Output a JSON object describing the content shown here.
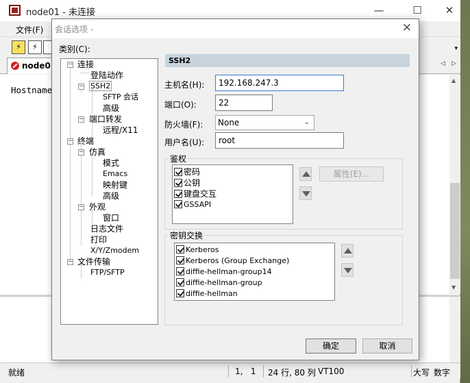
{
  "main_window": {
    "title": "node01 - 未连接",
    "controls": {
      "minimize": "—",
      "maximize": "☐",
      "close": "✕"
    },
    "menu": {
      "file": "文件(F)"
    },
    "toolbar_chevron": "▾",
    "tab": {
      "label": "node01"
    },
    "tab_nav": {
      "prev": "◁",
      "next": "▷"
    },
    "terminal_text": "Hostname",
    "scroll": {
      "up": "▲",
      "down": "▼"
    },
    "statusbar": {
      "ready": "就绪",
      "cursor": "1,   1",
      "rows_cols": "24 行, 80 列",
      "terminal_type": "VT100",
      "caps": "大写",
      "num": "数字"
    }
  },
  "dialog": {
    "title": "会话选项 -",
    "close": "✕",
    "category_label": "类别(C):",
    "tree": [
      {
        "label": "连接"
      },
      {
        "label": "登陆动作"
      },
      {
        "label": "SSH2"
      },
      {
        "label": "SFTP 会话"
      },
      {
        "label": "高级"
      },
      {
        "label": "端口转发"
      },
      {
        "label": "远程/X11"
      },
      {
        "label": "终端"
      },
      {
        "label": "仿真"
      },
      {
        "label": "模式"
      },
      {
        "label": "Emacs"
      },
      {
        "label": "映射键"
      },
      {
        "label": "高级"
      },
      {
        "label": "外观"
      },
      {
        "label": "窗口"
      },
      {
        "label": "日志文件"
      },
      {
        "label": "打印"
      },
      {
        "label": "X/Y/Zmodem"
      },
      {
        "label": "文件传输"
      },
      {
        "label": "FTP/SFTP"
      }
    ],
    "section_title": "SSH2",
    "hostname": {
      "label": "主机名(H):",
      "value": "192.168.247.3"
    },
    "port": {
      "label": "端口(O):",
      "value": "22"
    },
    "firewall": {
      "label": "防火墙(F):",
      "value": "None"
    },
    "username": {
      "label": "用户名(U):",
      "value": "root"
    },
    "auth": {
      "title": "鉴权",
      "items": [
        "密码",
        "公钥",
        "键盘交互",
        "GSSAPI"
      ],
      "properties_button": "属性(E)..."
    },
    "kex": {
      "title": "密钥交换",
      "items": [
        "Kerberos",
        "Kerberos (Group Exchange)",
        "diffie-hellman-group14",
        "diffie-hellman-group",
        "diffie-hellman"
      ]
    },
    "ok_button": "确定",
    "cancel_button": "取消"
  }
}
